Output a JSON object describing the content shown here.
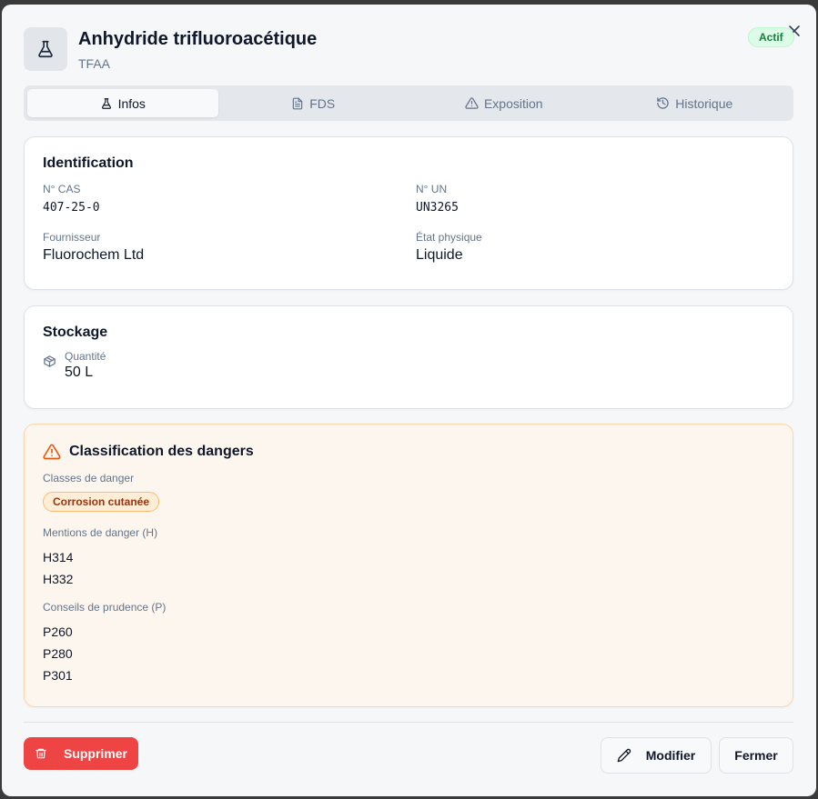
{
  "header": {
    "title": "Anhydride trifluoroacétique",
    "subtitle": "TFAA",
    "status_badge": "Actif",
    "icon": "flask-icon",
    "close_icon": "close-icon"
  },
  "tabs": [
    {
      "label": "Infos",
      "icon": "flask-icon",
      "active": true
    },
    {
      "label": "FDS",
      "icon": "document-icon",
      "active": false
    },
    {
      "label": "Exposition",
      "icon": "warning-icon",
      "active": false
    },
    {
      "label": "Historique",
      "icon": "history-icon",
      "active": false
    }
  ],
  "identification": {
    "title": "Identification",
    "cas_label": "N° CAS",
    "cas_value": "407-25-0",
    "un_label": "N° UN",
    "un_value": "UN3265",
    "supplier_label": "Fournisseur",
    "supplier_value": "Fluorochem Ltd",
    "state_label": "État physique",
    "state_value": "Liquide"
  },
  "storage": {
    "title": "Stockage",
    "quantity_label": "Quantité",
    "quantity_value": "50 L",
    "icon": "box-icon"
  },
  "hazards": {
    "title": "Classification des dangers",
    "icon": "warning-icon",
    "classes_label": "Classes de danger",
    "classes": [
      "Corrosion cutanée"
    ],
    "h_label": "Mentions de danger (H)",
    "h_statements": [
      "H314",
      "H332"
    ],
    "p_label": "Conseils de prudence (P)",
    "p_statements": [
      "P260",
      "P280",
      "P301"
    ]
  },
  "footer": {
    "delete_label": "Supprimer",
    "edit_label": "Modifier",
    "close_label": "Fermer"
  },
  "colors": {
    "danger": "#ef4444",
    "warning": "#ea580c",
    "success_bg": "#dcfce7",
    "success_text": "#15803d",
    "hazard_card_bg": "#fdf6ef"
  }
}
